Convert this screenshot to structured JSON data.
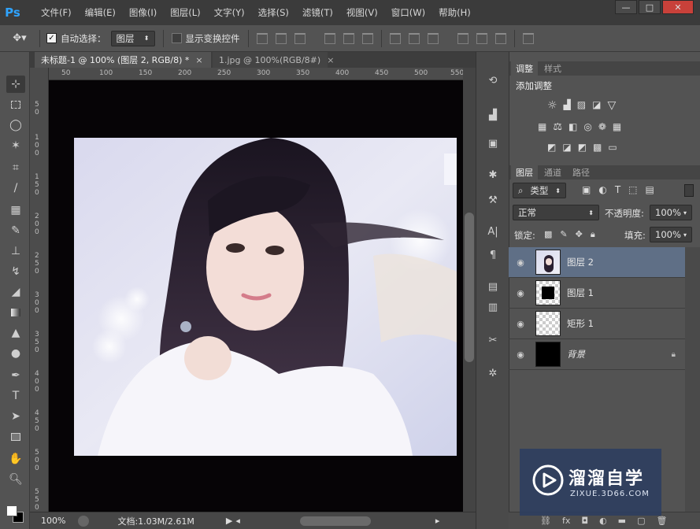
{
  "app": {
    "logo": "Ps"
  },
  "menu": [
    "文件(F)",
    "编辑(E)",
    "图像(I)",
    "图层(L)",
    "文字(Y)",
    "选择(S)",
    "滤镜(T)",
    "视图(V)",
    "窗口(W)",
    "帮助(H)"
  ],
  "window_controls": {
    "minimize": "—",
    "maximize": "□",
    "close": "✕"
  },
  "options": {
    "auto_select_label": "自动选择：",
    "auto_select_checked": true,
    "auto_select_value": "图层",
    "show_transform_label": "显示变换控件",
    "show_transform_checked": false
  },
  "tabs": [
    {
      "label": "未标题-1 @ 100% (图层 2, RGB/8) *",
      "close": "×"
    },
    {
      "label": "1.jpg @ 100%(RGB/8#)",
      "close": "×"
    }
  ],
  "ruler_ticks": [
    "50",
    "100",
    "150",
    "200",
    "250",
    "300",
    "350",
    "400",
    "450",
    "500",
    "550"
  ],
  "ruler_ticks_v": [
    "5",
    "0",
    "1",
    "0",
    "0",
    "1",
    "5",
    "0",
    "2",
    "0",
    "0",
    "2",
    "5",
    "0",
    "3",
    "0",
    "0",
    "3",
    "5",
    "0",
    "4",
    "0",
    "0",
    "4",
    "5",
    "0",
    "5",
    "0",
    "0",
    "5",
    "5",
    "0"
  ],
  "status": {
    "zoom": "100%",
    "doc": "文档:1.03M/2.61M"
  },
  "adjustments": {
    "tabs": [
      "调整",
      "样式"
    ],
    "title": "添加调整"
  },
  "layers_panel": {
    "tabs": [
      "图层",
      "通道",
      "路径"
    ],
    "filter_label": "类型",
    "blend_mode": "正常",
    "opacity_label": "不透明度:",
    "opacity_value": "100%",
    "lock_label": "锁定:",
    "fill_label": "填充:",
    "fill_value": "100%",
    "layers": [
      {
        "name": "图层 2",
        "selected": true,
        "thumb": "photo"
      },
      {
        "name": "图层 1",
        "selected": false,
        "thumb": "black-square"
      },
      {
        "name": "矩形 1",
        "selected": false,
        "thumb": "transparent"
      },
      {
        "name": "背景",
        "selected": false,
        "thumb": "black",
        "locked": true
      }
    ]
  },
  "watermark": {
    "title": "溜溜自学",
    "url": "ZIXUE.3D66.COM"
  },
  "colors": {
    "accent": "#2fa3ff",
    "selected_layer": "#5f6f86",
    "canvas": "#060406"
  }
}
